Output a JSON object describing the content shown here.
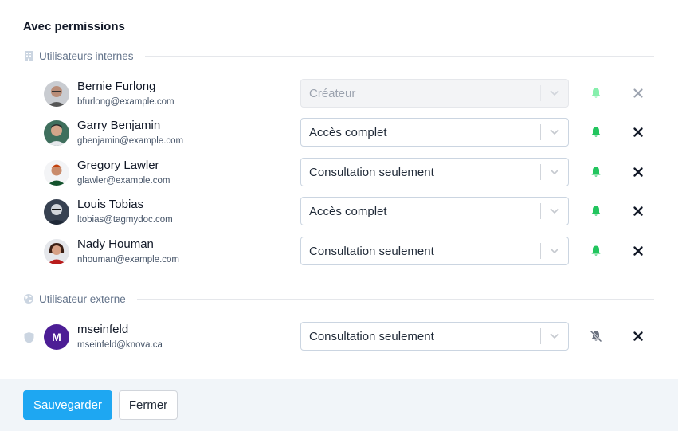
{
  "title": "Avec permissions",
  "internal": {
    "label": "Utilisateurs internes",
    "icon": "building-icon",
    "users": [
      {
        "name": "Bernie Furlong",
        "email": "bfurlong@example.com",
        "role": "Créateur",
        "disabled": true,
        "notify": true
      },
      {
        "name": "Garry Benjamin",
        "email": "gbenjamin@example.com",
        "role": "Accès complet",
        "disabled": false,
        "notify": true
      },
      {
        "name": "Gregory Lawler",
        "email": "glawler@example.com",
        "role": "Consultation seulement",
        "disabled": false,
        "notify": true
      },
      {
        "name": "Louis Tobias",
        "email": "ltobias@tagmydoc.com",
        "role": "Accès complet",
        "disabled": false,
        "notify": true
      },
      {
        "name": "Nady Houman",
        "email": "nhouman@example.com",
        "role": "Consultation seulement",
        "disabled": false,
        "notify": true
      }
    ]
  },
  "external": {
    "label": "Utilisateur externe",
    "icon": "globe-icon",
    "users": [
      {
        "name": "mseinfeld",
        "email": "mseinfeld@knova.ca",
        "initial": "M",
        "role": "Consultation seulement",
        "disabled": false,
        "notify": false
      }
    ]
  },
  "footer": {
    "save_label": "Sauvegarder",
    "close_label": "Fermer"
  },
  "colors": {
    "primary": "#1ea7f2",
    "bell_on": "#22c55e",
    "bell_off": "#6b7280",
    "avatar_m": "#4c1d95"
  }
}
